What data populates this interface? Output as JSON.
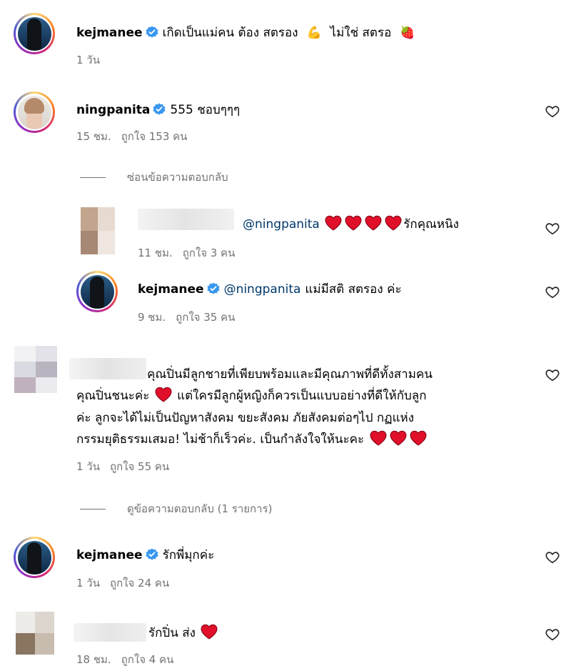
{
  "comments": [
    {
      "username": "kejmanee",
      "text": "เกิดเป็นแม่คน ต้อง สตรอง",
      "emoji_1": "💪",
      "text_2": "ไม่ใช่ สตรอ",
      "emoji_2": "🍓",
      "time": "1 วัน"
    },
    {
      "username": "ningpanita",
      "text": "555 ชอบๆๆๆ",
      "time": "15 ชม.",
      "likes": "ถูกใจ 153 คน",
      "hide_replies": "ซ่อนข้อความตอบกลับ"
    }
  ],
  "replies": [
    {
      "mention": "@ningpanita",
      "text": "รักคุณหนิง",
      "time": "11 ชม.",
      "likes": "ถูกใจ 3 คน"
    },
    {
      "username": "kejmanee",
      "mention": "@ningpanita",
      "text": "แม่มีสติ สตรอง ค่ะ",
      "time": "9 ชม.",
      "likes": "ถูกใจ 35 คน"
    }
  ],
  "long_comment": {
    "lines": [
      "คุณปิ่นมีลูกชายที่เพียบพร้อมและมีคุณภาพที่ดีทั้งสามคน",
      "คุณปิ่นชนะค่ะ",
      "แต่ใครมีลูกผู้หญิงก็ควรเป็นแบบอย่างที่ดีให้กับลูก",
      "ค่ะ ลูกจะได้ไม่เป็นปัญหาสังคม ขยะสังคม ภัยสังคมต่อๆไป กฏแห่ง",
      "กรรมยุติธรรมเสมอ! ไม่ช้าก็เร็วค่ะ. เป็นกำลังใจให้นะคะ"
    ],
    "time": "1 วัน",
    "likes": "ถูกใจ 55 คน",
    "view_replies": "ดูข้อความตอบกลับ (1 รายการ)"
  },
  "kej_reply": {
    "username": "kejmanee",
    "text": "รักพี่มุกค่ะ",
    "time": "1 วัน",
    "likes": "ถูกใจ 24 คน"
  },
  "last_comment": {
    "text": "รักปิ่น ส่ง",
    "time": "18 ชม.",
    "likes": "ถูกใจ 4 คน"
  },
  "colors": {
    "verified": "#3897f0",
    "heart_red": "#e0102a",
    "meta_gray": "#737373",
    "mention": "#00376b"
  }
}
